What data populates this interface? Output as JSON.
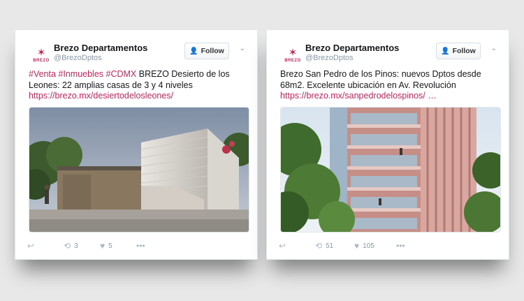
{
  "colors": {
    "accent": "#c8255b",
    "muted": "#8899a6",
    "follow_icon": "#55acee"
  },
  "tweets": [
    {
      "avatar_brand": "BREZO",
      "name": "Brezo Departamentos",
      "handle": "@BrezoDptos",
      "follow_label": "Follow",
      "hashtags": "#Venta #Inmuebles #CDMX",
      "text": " BREZO Desierto de los Leones: 22 amplias casas de 3 y 4 niveles",
      "url": "https://brezo.mx/desiertodelosleones/",
      "media_icon": "modern-house-render",
      "retweets": "3",
      "likes": "5"
    },
    {
      "avatar_brand": "BREZO",
      "name": "Brezo Departamentos",
      "handle": "@BrezoDptos",
      "follow_label": "Follow",
      "text": "Brezo San Pedro de los Pinos: nuevos Dptos desde 68m2. Excelente ubicación en Av. Revolución",
      "url": "https://brezo.mx/sanpedrodelospinos/ …",
      "media_icon": "apartment-building-render",
      "retweets": "51",
      "likes": "105"
    }
  ],
  "icons": {
    "reply": "reply-icon",
    "retweet": "retweet-icon",
    "like": "heart-icon",
    "more": "more-icon",
    "follow": "add-person-icon",
    "caret": "chevron-down-icon"
  }
}
